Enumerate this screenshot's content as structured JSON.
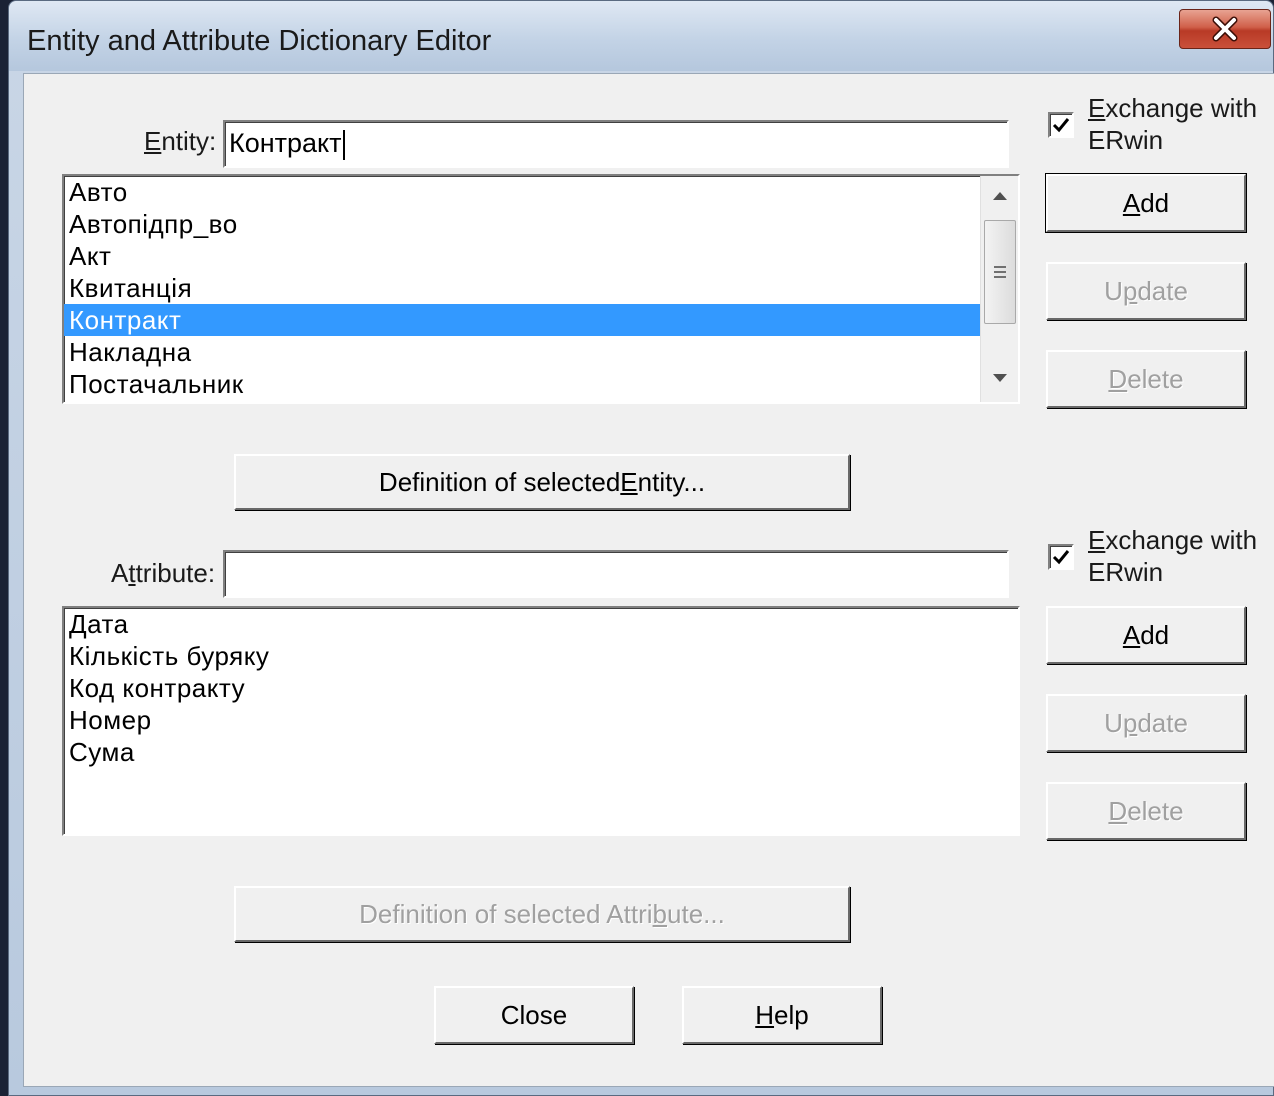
{
  "window": {
    "title": "Entity and Attribute Dictionary Editor"
  },
  "entity": {
    "label_prefix": "",
    "label_mnemonic": "E",
    "label_rest": "ntity:",
    "value": "Контракт",
    "items": [
      "Авто",
      "Автопідпр_во",
      "Акт",
      "Квитанція",
      "Контракт",
      "Накладна",
      "Постачальник"
    ],
    "selected": "Контракт",
    "exchange": {
      "mnemonic": "E",
      "line1_rest": "xchange with",
      "line2": "ERwin",
      "checked": true
    },
    "add": {
      "mnemonic": "A",
      "rest": "dd"
    },
    "update": {
      "before": "U",
      "mnemonic": "p",
      "after": "date"
    },
    "delete": {
      "mnemonic": "D",
      "rest": "elete"
    },
    "definition": {
      "before": "Definition of selected ",
      "mnemonic": "E",
      "after": "ntity..."
    }
  },
  "attribute": {
    "label_before": "A",
    "label_mnemonic": "t",
    "label_after": "tribute:",
    "value": "",
    "items": [
      "Дата",
      "Кількість буряку",
      "Код контракту",
      "Номер",
      "Сума"
    ],
    "exchange": {
      "mnemonic": "E",
      "line1_rest": "xchange with",
      "line2": "ERwin",
      "checked": true
    },
    "add": {
      "mnemonic": "A",
      "rest": "dd"
    },
    "update": {
      "before": "U",
      "mnemonic": "p",
      "after": "date"
    },
    "delete": {
      "mnemonic": "D",
      "rest": "elete"
    },
    "definition": {
      "before": "Definition of selected Attri",
      "mnemonic": "b",
      "after": "ute..."
    }
  },
  "footer": {
    "close": "Close",
    "help": {
      "mnemonic": "H",
      "rest": "elp"
    }
  },
  "colors": {
    "selection": "#3399ff",
    "dialog_bg": "#f0f0f0",
    "close_button": "#c9503a"
  }
}
